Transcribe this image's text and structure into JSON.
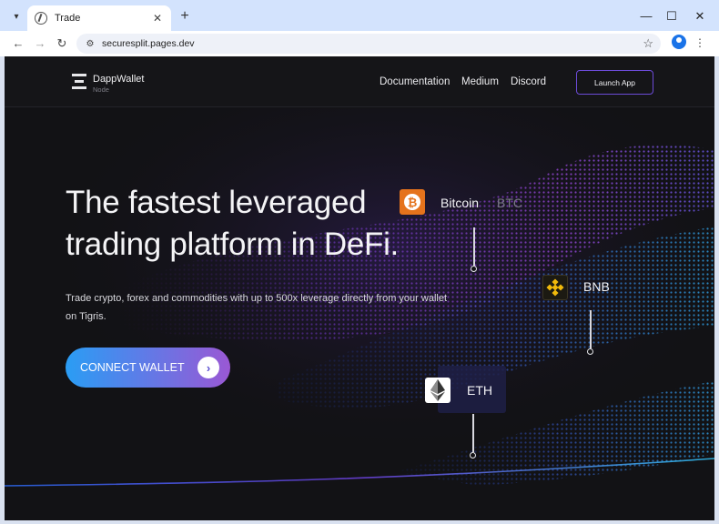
{
  "browser": {
    "tab_title": "Trade",
    "url": "securesplit.pages.dev",
    "tab_close": "✕",
    "new_tab": "+",
    "minimize": "—",
    "maximize": "☐",
    "close": "✕"
  },
  "header": {
    "brand_name": "DappWallet",
    "brand_sub": "Node",
    "nav": [
      "Documentation",
      "Medium",
      "Discord"
    ],
    "launch_label": "Launch App"
  },
  "hero": {
    "headline_line1": "The fastest leveraged",
    "headline_line2": "trading platform in DeFi.",
    "subtext": "Trade crypto, forex and commodities with up to 500x leverage directly from your wallet on Tigris.",
    "connect_label": "CONNECT WALLET"
  },
  "coins": {
    "btc_name": "Bitcoin",
    "btc_ticker": "BTC",
    "bnb_name": "BNB",
    "eth_name": "ETH"
  },
  "colors": {
    "accent_purple": "#6c4bd8",
    "button_start": "#2a9df4",
    "button_end": "#9a58d4",
    "btc_orange": "#e5731c",
    "bnb_gold": "#f0b90b"
  }
}
